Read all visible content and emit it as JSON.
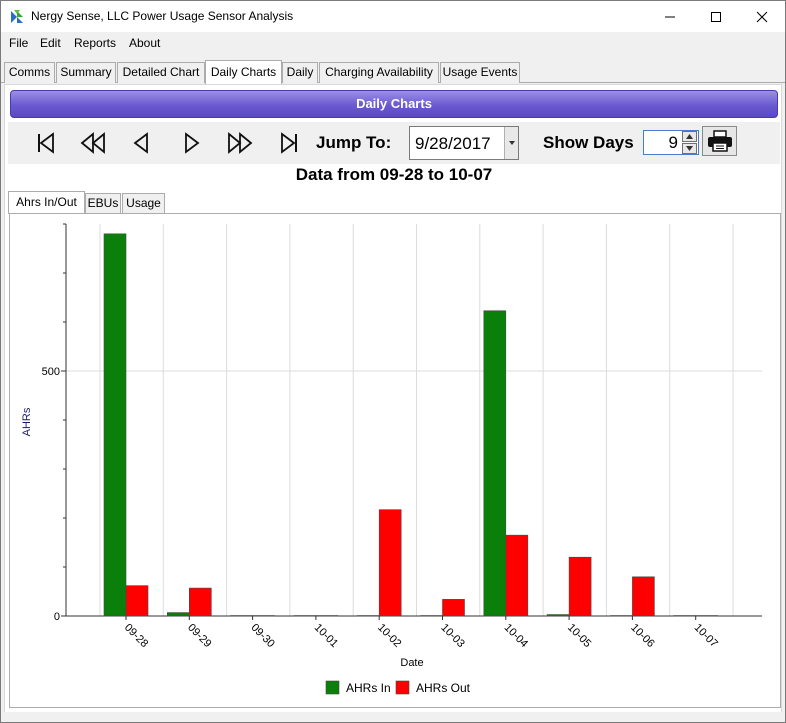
{
  "window": {
    "title": "Nergy Sense, LLC Power Usage Sensor Analysis",
    "minimize_icon": "minimize-icon",
    "maximize_icon": "maximize-icon",
    "close_icon": "close-icon"
  },
  "menu": [
    "File",
    "Edit",
    "Reports",
    "About"
  ],
  "tabs": [
    {
      "label": "Comms"
    },
    {
      "label": "Summary"
    },
    {
      "label": "Detailed Chart"
    },
    {
      "label": "Daily Charts",
      "active": true
    },
    {
      "label": "Daily"
    },
    {
      "label": "Charging Availability"
    },
    {
      "label": "Usage Events"
    }
  ],
  "banner": "Daily Charts",
  "toolbar": {
    "nav_icons": [
      "first-icon",
      "rewind-icon",
      "previous-icon",
      "next-icon",
      "fast-forward-icon",
      "last-icon"
    ],
    "jump_label": "Jump To:",
    "date_value": "9/28/2017",
    "show_label": "Show Days",
    "days_value": "9",
    "print_icon": "printer-icon"
  },
  "range_title": "Data from 09-28 to 10-07",
  "subtabs": [
    {
      "label": "Ahrs In/Out",
      "active": true
    },
    {
      "label": "EBUs"
    },
    {
      "label": "Usage"
    }
  ],
  "colors": {
    "ahrs_in": "#0a7f0a",
    "ahrs_out": "#ff0000",
    "banner": "#6a5ad0"
  },
  "chart_data": {
    "type": "bar",
    "categories": [
      "09-28",
      "09-29",
      "09-30",
      "10-01",
      "10-02",
      "10-03",
      "10-04",
      "10-05",
      "10-06",
      "10-07"
    ],
    "series": [
      {
        "name": "AHRs In",
        "values": [
          780,
          7,
          0,
          0,
          0,
          0,
          623,
          3,
          0,
          0
        ]
      },
      {
        "name": "AHRs Out",
        "values": [
          62,
          57,
          0,
          0,
          217,
          34,
          165,
          120,
          80,
          0
        ]
      }
    ],
    "xlabel": "Date",
    "ylabel": "AHRs",
    "ylim": [
      0,
      800
    ],
    "yticks": [
      "0",
      "500"
    ],
    "grid": "vertical",
    "legend": "bottom-center"
  }
}
